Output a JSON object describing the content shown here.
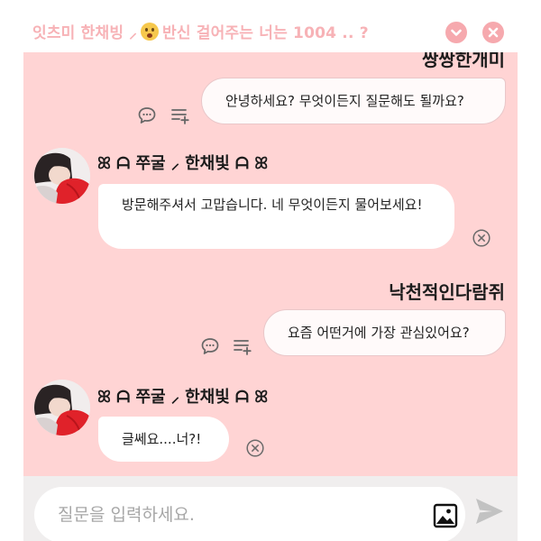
{
  "header": {
    "title_part1": "잇츠미 한채빙 ⸝",
    "emoji": "face-with-hand-over-mouth",
    "title_part2": "반신 걸어주는 너는 1004 .. ?",
    "accent_color": "#f7b2b6"
  },
  "chat": {
    "background_color": "#ffd4d4",
    "user_name_top": "쌍쌍한개미",
    "user_message_1": "안녕하세요? 무엇이든지 질문해도 될까요?",
    "bot_name": "ꕤ ᗩ 쭈굴 ⸝ 한채빛 ᗩ ꕤ",
    "bot_reply_1": "방문해주셔서 고맙습니다. 네 무엇이든지 물어보세요!",
    "user_name_2": "낙천적인다람쥐",
    "user_message_2": "요즘 어떤거에 가장 관심있어요?",
    "bot_reply_2": "글쎄요....너?!"
  },
  "footer": {
    "input_placeholder": "질문을 입력하세요.",
    "input_value": ""
  },
  "icons": {
    "minimize": "chevron-down-icon",
    "close": "close-icon",
    "comment": "comment-icon",
    "playlist": "playlist-add-icon",
    "dismiss": "circle-close-icon",
    "image": "image-icon",
    "send": "send-icon"
  }
}
